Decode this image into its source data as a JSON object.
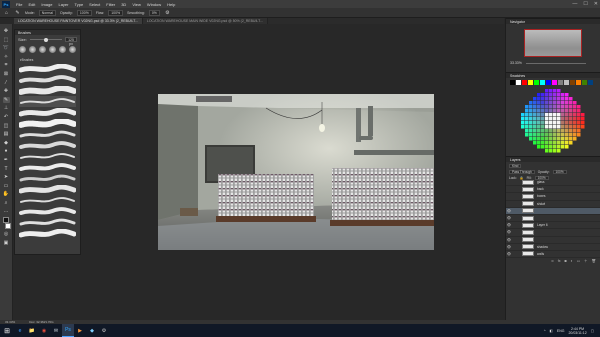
{
  "app": {
    "logo": "Ps",
    "menu": [
      "File",
      "Edit",
      "Image",
      "Layer",
      "Type",
      "Select",
      "Filter",
      "3D",
      "View",
      "Window",
      "Help"
    ],
    "window_controls": [
      "—",
      "☐",
      "✕"
    ]
  },
  "options_bar": {
    "mode_label": "Mode:",
    "mode_value": "Normal",
    "opacity_label": "Opacity:",
    "opacity_value": "100%",
    "flow_label": "Flow:",
    "flow_value": "100%",
    "smoothing_label": "Smoothing:",
    "smoothing_value": "0%"
  },
  "tabs": [
    {
      "label": "LOCATION WAREHOUSE PAINTOVER V02NG.psd @ 33.3% (2_REBUILT...",
      "active": true
    },
    {
      "label": "LOCATION WAREHOUSE MAIN WIDE V02NG.psd @ 50% (2_REBUILT...",
      "active": false
    }
  ],
  "brush_panel": {
    "title": "Brushes",
    "size_label": "Size:",
    "size_value": "125 px",
    "folder_label": "Brushes"
  },
  "panels": {
    "navigator_title": "Navigator",
    "navigator_zoom": "33.33%",
    "swatches_title": "Swatches",
    "layers_title": "Layers",
    "layers_kind": "Kind",
    "layers_blend": "Pass Through",
    "layers_opacity_label": "Opacity:",
    "layers_opacity": "100%",
    "layers_lock_label": "Lock:",
    "layers_fill_label": "Fill:",
    "layers_fill": "100%"
  },
  "swatch_colors": [
    "#000000",
    "#ffffff",
    "#ff0000",
    "#ffff00",
    "#00ff00",
    "#00ffff",
    "#0000ff",
    "#ff00ff",
    "#808080",
    "#c0c0c0",
    "#804000",
    "#ff8000",
    "#408000",
    "#004080"
  ],
  "layers": [
    {
      "name": "glass",
      "visible": false,
      "selected": false
    },
    {
      "name": "back",
      "visible": false,
      "selected": false
    },
    {
      "name": "boxes",
      "visible": false,
      "selected": false
    },
    {
      "name": "shdwl",
      "visible": false,
      "selected": false
    },
    {
      "name": "",
      "visible": true,
      "selected": true
    },
    {
      "name": "",
      "visible": true,
      "selected": false
    },
    {
      "name": "Layer 6",
      "visible": true,
      "selected": false
    },
    {
      "name": "",
      "visible": true,
      "selected": false
    },
    {
      "name": "",
      "visible": true,
      "selected": false
    },
    {
      "name": "shadow",
      "visible": true,
      "selected": false
    },
    {
      "name": "walls",
      "visible": true,
      "selected": false
    }
  ],
  "status": {
    "zoom": "33.33%",
    "doc": "Doc: 32.3M/1.70G"
  },
  "taskbar": {
    "apps": [
      "e",
      "📁",
      "◉",
      "✉",
      "Ps",
      "▶",
      "◆",
      "⚙"
    ],
    "tray_items": [
      "^",
      "◧",
      "ENG"
    ],
    "time": "2:44 PM",
    "date": "20/03/11:12"
  }
}
